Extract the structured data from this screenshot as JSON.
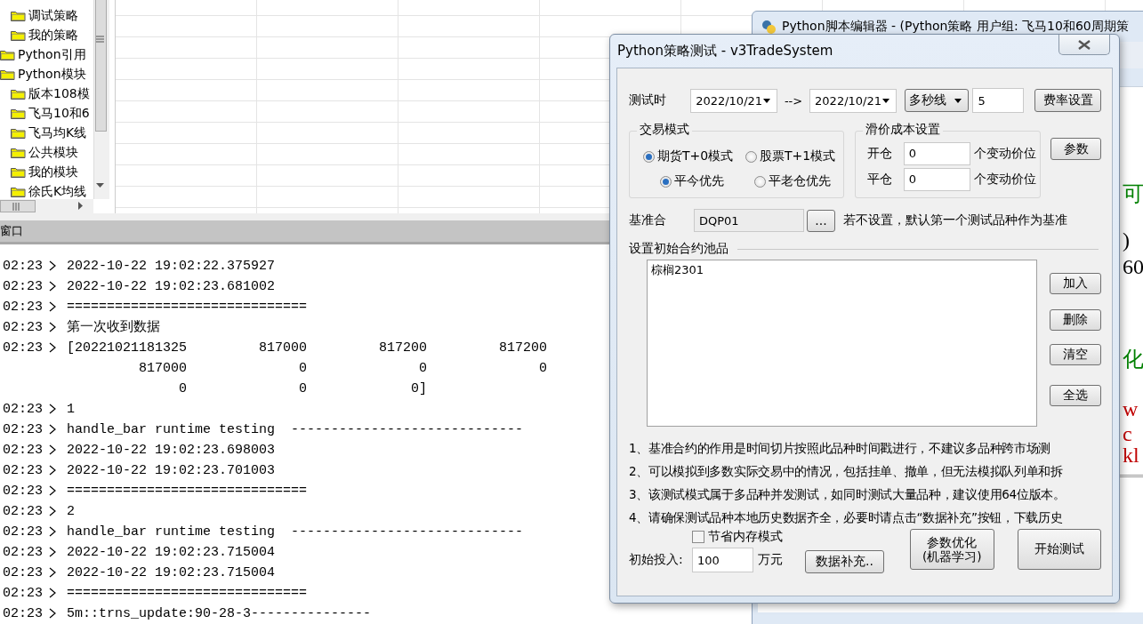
{
  "tree": {
    "items": [
      {
        "children": [
          {
            "label": "调试策略"
          },
          {
            "label": "我的策略"
          }
        ]
      },
      {
        "label": "Python引用"
      },
      {
        "label": "Python模块",
        "children": [
          {
            "label": "版本108模"
          },
          {
            "label": "飞马10和6"
          },
          {
            "label": "飞马均K线"
          },
          {
            "label": "公共模块"
          },
          {
            "label": "我的模块"
          },
          {
            "label": "徐氏K均线"
          }
        ]
      }
    ]
  },
  "console": {
    "title": "窗口",
    "lines": [
      {
        "kind": "log",
        "time": "02:23",
        "text": "2022-10-22 19:02:22.375927"
      },
      {
        "kind": "log",
        "time": "02:23",
        "text": "2022-10-22 19:02:23.681002"
      },
      {
        "kind": "log",
        "time": "02:23",
        "text": "=============================="
      },
      {
        "kind": "log",
        "time": "02:23",
        "text": "第一次收到数据"
      },
      {
        "kind": "columns",
        "time": "02:23",
        "cells": [
          "[20221021181325",
          "817000",
          "817200",
          "817200"
        ]
      },
      {
        "kind": "continuation",
        "cells": [
          "817000",
          "0",
          "0",
          "0"
        ]
      },
      {
        "kind": "continuation",
        "cells": [
          "0",
          "0",
          "0]"
        ]
      },
      {
        "kind": "log",
        "time": "02:23",
        "text": "1"
      },
      {
        "kind": "log",
        "time": "02:23",
        "text": "handle_bar runtime testing  -----------------------------"
      },
      {
        "kind": "log",
        "time": "02:23",
        "text": "2022-10-22 19:02:23.698003"
      },
      {
        "kind": "log",
        "time": "02:23",
        "text": "2022-10-22 19:02:23.701003"
      },
      {
        "kind": "log",
        "time": "02:23",
        "text": "=============================="
      },
      {
        "kind": "log",
        "time": "02:23",
        "text": "2"
      },
      {
        "kind": "log",
        "time": "02:23",
        "text": "handle_bar runtime testing  -----------------------------"
      },
      {
        "kind": "log",
        "time": "02:23",
        "text": "2022-10-22 19:02:23.715004"
      },
      {
        "kind": "log",
        "time": "02:23",
        "text": "2022-10-22 19:02:23.715004"
      },
      {
        "kind": "log",
        "time": "02:23",
        "text": "=============================="
      },
      {
        "kind": "log",
        "time": "02:23",
        "text": "5m::trns_update:90-28-3---------------"
      }
    ]
  },
  "editor": {
    "title": "Python脚本编辑器 - (Python策略 用户组: 飞马10和60周期策",
    "code_fragments": [
      {
        "text": "可",
        "color": "#008000"
      },
      {
        "text": ")",
        "color": "#000000"
      },
      {
        "text": "60",
        "color": "#000000"
      },
      {
        "text": "化",
        "color": "#008000"
      },
      {
        "text": "w",
        "color": "#c00000"
      },
      {
        "text": "c",
        "color": "#c00000"
      },
      {
        "text": "kl",
        "color": "#c00000"
      }
    ]
  },
  "dialog": {
    "title": "Python策略测试 - v3TradeSystem",
    "time_label": "测试时",
    "start_date": "2022/10/21",
    "arrow": "-->",
    "end_date": "2022/10/21",
    "period": "多秒线",
    "period_value": "5",
    "fee_button": "费率设置",
    "trade_mode": {
      "title": "交易模式",
      "rows": [
        [
          {
            "label": "期货T+0模式",
            "selected": true
          },
          {
            "label": "股票T+1模式",
            "selected": false
          }
        ],
        [
          {
            "label": "平今优先",
            "selected": true
          },
          {
            "label": "平老仓优先",
            "selected": false
          }
        ]
      ]
    },
    "slippage": {
      "title": "滑价成本设置",
      "rows": [
        {
          "label": "开仓",
          "value": "0",
          "unit": "个变动价位"
        },
        {
          "label": "平仓",
          "value": "0",
          "unit": "个变动价位"
        }
      ]
    },
    "params_button": "参数",
    "benchmark": {
      "label": "基准合",
      "value": "DQP01",
      "browse": "...",
      "note": "若不设置，默认第一个测试品种作为基准"
    },
    "pool": {
      "title": "设置初始合约池品",
      "items": [
        "棕榈2301"
      ],
      "buttons": [
        "加入",
        "删除",
        "清空",
        "全选"
      ]
    },
    "notes": [
      "1、基准合约的作用是时间切片按照此品种时间戳进行，不建议多品种跨市场测",
      "2、可以模拟到多数实际交易中的情况，包括挂单、撤单，但无法模拟队列单和拆",
      "3、该测试模式属于多品种并发测试，如同时测试大量品种，建议使用64位版本。",
      "4、请确保测试品种本地历史数据齐全，必要时请点击“数据补充”按钮，下载历史"
    ],
    "memory_mode": {
      "label": "节省内存模式",
      "checked": false
    },
    "capital": {
      "label": "初始投入:",
      "value": "100",
      "unit": "万元"
    },
    "data_button": "数据补充..",
    "optimize_button": [
      "参数优化",
      "(机器学习)"
    ],
    "start_button": "开始测试"
  }
}
